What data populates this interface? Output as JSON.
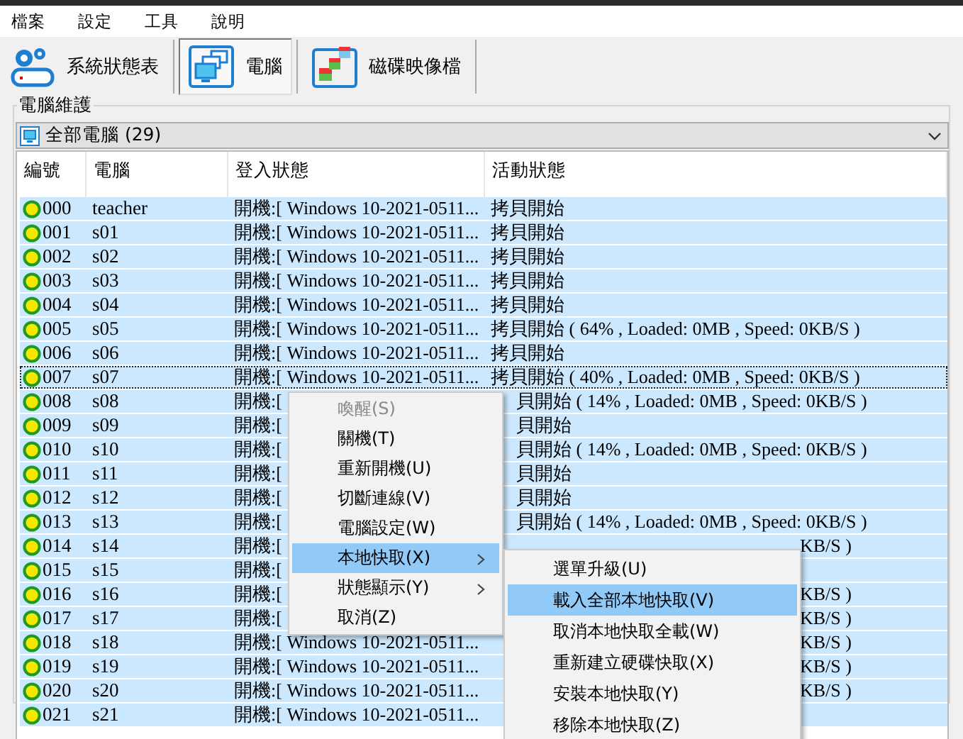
{
  "menu_bar": [
    "檔案",
    "設定",
    "工具",
    "說明"
  ],
  "toolbar": [
    {
      "kind": "status",
      "label": "系統狀態表",
      "selected": false
    },
    {
      "kind": "computer",
      "label": "電腦",
      "selected": true
    },
    {
      "kind": "image",
      "label": "磁碟映像檔",
      "selected": false
    }
  ],
  "group_title": "電腦維護",
  "group_select": {
    "label": "全部電腦 (29)"
  },
  "table": {
    "columns": [
      "編號",
      "電腦",
      "登入狀態",
      "活動狀態"
    ],
    "rows": [
      {
        "id": "000",
        "name": "teacher",
        "login": "開機:[ Windows 10-2021-0511...",
        "activity": "拷貝開始",
        "selected": true,
        "focused": false
      },
      {
        "id": "001",
        "name": "s01",
        "login": "開機:[ Windows 10-2021-0511...",
        "activity": "拷貝開始",
        "selected": true,
        "focused": false
      },
      {
        "id": "002",
        "name": "s02",
        "login": "開機:[ Windows 10-2021-0511...",
        "activity": "拷貝開始",
        "selected": true,
        "focused": false
      },
      {
        "id": "003",
        "name": "s03",
        "login": "開機:[ Windows 10-2021-0511...",
        "activity": "拷貝開始",
        "selected": true,
        "focused": false
      },
      {
        "id": "004",
        "name": "s04",
        "login": "開機:[ Windows 10-2021-0511...",
        "activity": "拷貝開始",
        "selected": true,
        "focused": false
      },
      {
        "id": "005",
        "name": "s05",
        "login": "開機:[ Windows 10-2021-0511...",
        "activity": "拷貝開始 ( 64% , Loaded: 0MB , Speed: 0KB/S )",
        "selected": true,
        "focused": false
      },
      {
        "id": "006",
        "name": "s06",
        "login": "開機:[ Windows 10-2021-0511...",
        "activity": "拷貝開始",
        "selected": true,
        "focused": false
      },
      {
        "id": "007",
        "name": "s07",
        "login": "開機:[ Windows 10-2021-0511...",
        "activity": "拷貝開始 ( 40% , Loaded: 0MB , Speed: 0KB/S )",
        "selected": true,
        "focused": true
      },
      {
        "id": "008",
        "name": "s08",
        "login": "開機:[",
        "activity": "貝開始 ( 14% , Loaded: 0MB , Speed: 0KB/S )",
        "under_menu": true,
        "selected": true,
        "focused": false
      },
      {
        "id": "009",
        "name": "s09",
        "login": "開機:[",
        "activity": "貝開始",
        "under_menu": true,
        "selected": true,
        "focused": false
      },
      {
        "id": "010",
        "name": "s10",
        "login": "開機:[",
        "activity": "貝開始 ( 14% , Loaded: 0MB , Speed: 0KB/S )",
        "under_menu": true,
        "selected": true,
        "focused": false
      },
      {
        "id": "011",
        "name": "s11",
        "login": "開機:[",
        "activity": "貝開始",
        "under_menu": true,
        "selected": true,
        "focused": false
      },
      {
        "id": "012",
        "name": "s12",
        "login": "開機:[",
        "activity": "貝開始",
        "under_menu": true,
        "selected": true,
        "focused": false
      },
      {
        "id": "013",
        "name": "s13",
        "login": "開機:[",
        "activity": "貝開始 ( 14% , Loaded: 0MB , Speed: 0KB/S )",
        "under_menu": true,
        "selected": true,
        "focused": false
      },
      {
        "id": "014",
        "name": "s14",
        "login": "開機:[",
        "activity": "KB/S )",
        "under_submenu": true,
        "selected": true,
        "focused": false
      },
      {
        "id": "015",
        "name": "s15",
        "login": "開機:[",
        "selected": true,
        "focused": false
      },
      {
        "id": "016",
        "name": "s16",
        "login": "開機:[",
        "activity": "KB/S )",
        "under_submenu": true,
        "selected": true,
        "focused": false
      },
      {
        "id": "017",
        "name": "s17",
        "login": "開機:[",
        "activity": "KB/S )",
        "under_submenu": true,
        "selected": true,
        "focused": false
      },
      {
        "id": "018",
        "name": "s18",
        "login": "開機:[ Windows 10-2021-0511...",
        "activity": "KB/S )",
        "under_submenu": true,
        "selected": true,
        "focused": false
      },
      {
        "id": "019",
        "name": "s19",
        "login": "開機:[ Windows 10-2021-0511...",
        "activity": "KB/S )",
        "under_submenu": true,
        "selected": true,
        "focused": false
      },
      {
        "id": "020",
        "name": "s20",
        "login": "開機:[ Windows 10-2021-0511...",
        "activity": "KB/S )",
        "under_submenu": true,
        "selected": true,
        "focused": false
      },
      {
        "id": "021",
        "name": "s21",
        "login": "開機:[ Windows 10-2021-0511...",
        "selected": true,
        "focused": false
      }
    ]
  },
  "context_menu": [
    {
      "label": "喚醒(S)",
      "disabled": true,
      "submenu": false,
      "selected": false
    },
    {
      "label": "關機(T)",
      "disabled": false,
      "submenu": false,
      "selected": false
    },
    {
      "label": "重新開機(U)",
      "disabled": false,
      "submenu": false,
      "selected": false
    },
    {
      "label": "切斷連線(V)",
      "disabled": false,
      "submenu": false,
      "selected": false
    },
    {
      "label": "電腦設定(W)",
      "disabled": false,
      "submenu": false,
      "selected": false
    },
    {
      "label": "本地快取(X)",
      "disabled": false,
      "submenu": true,
      "selected": true
    },
    {
      "label": "狀態顯示(Y)",
      "disabled": false,
      "submenu": true,
      "selected": false
    },
    {
      "label": "取消(Z)",
      "disabled": false,
      "submenu": false,
      "selected": false
    }
  ],
  "submenu": [
    {
      "label": "選單升級(U)",
      "selected": false
    },
    {
      "label": "載入全部本地快取(V)",
      "selected": true
    },
    {
      "label": "取消本地快取全載(W)",
      "selected": false
    },
    {
      "label": "重新建立硬碟快取(X)",
      "selected": false
    },
    {
      "label": "安裝本地快取(Y)",
      "selected": false
    },
    {
      "label": "移除本地快取(Z)",
      "selected": false
    }
  ]
}
